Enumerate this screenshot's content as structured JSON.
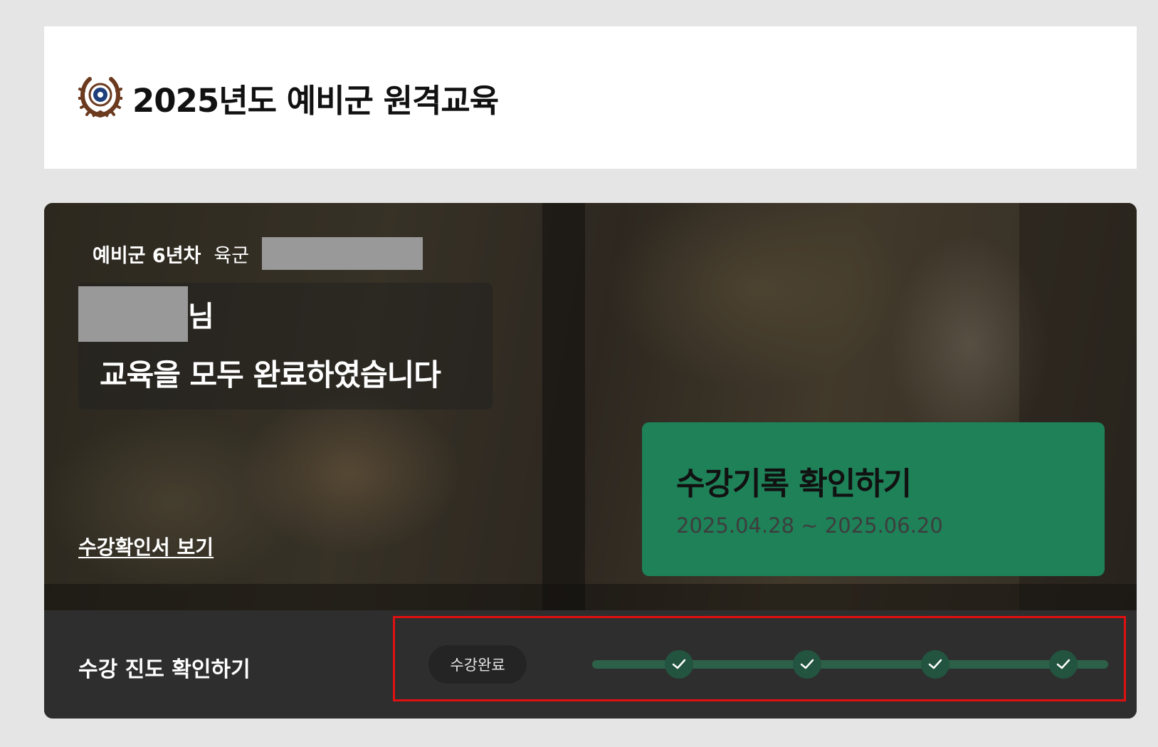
{
  "header": {
    "logo": "reserve-forces-emblem",
    "title": "2025년도 예비군 원격교육"
  },
  "trainee": {
    "year_label": "예비군 6년차",
    "branch": "육군",
    "name_suffix": "님",
    "completion_message": "교육을 모두 완료하였습니다"
  },
  "links": {
    "certificate": "수강확인서 보기"
  },
  "record": {
    "title": "수강기록 확인하기",
    "period": "2025.04.28 ~ 2025.06.20"
  },
  "progress": {
    "label": "수강 진도 확인하기",
    "status": "수강완료",
    "steps_completed": 4,
    "steps_total": 4
  },
  "colors": {
    "accent_green": "#1e8158",
    "track_green": "#2c6049",
    "highlight_red": "#e01010"
  }
}
